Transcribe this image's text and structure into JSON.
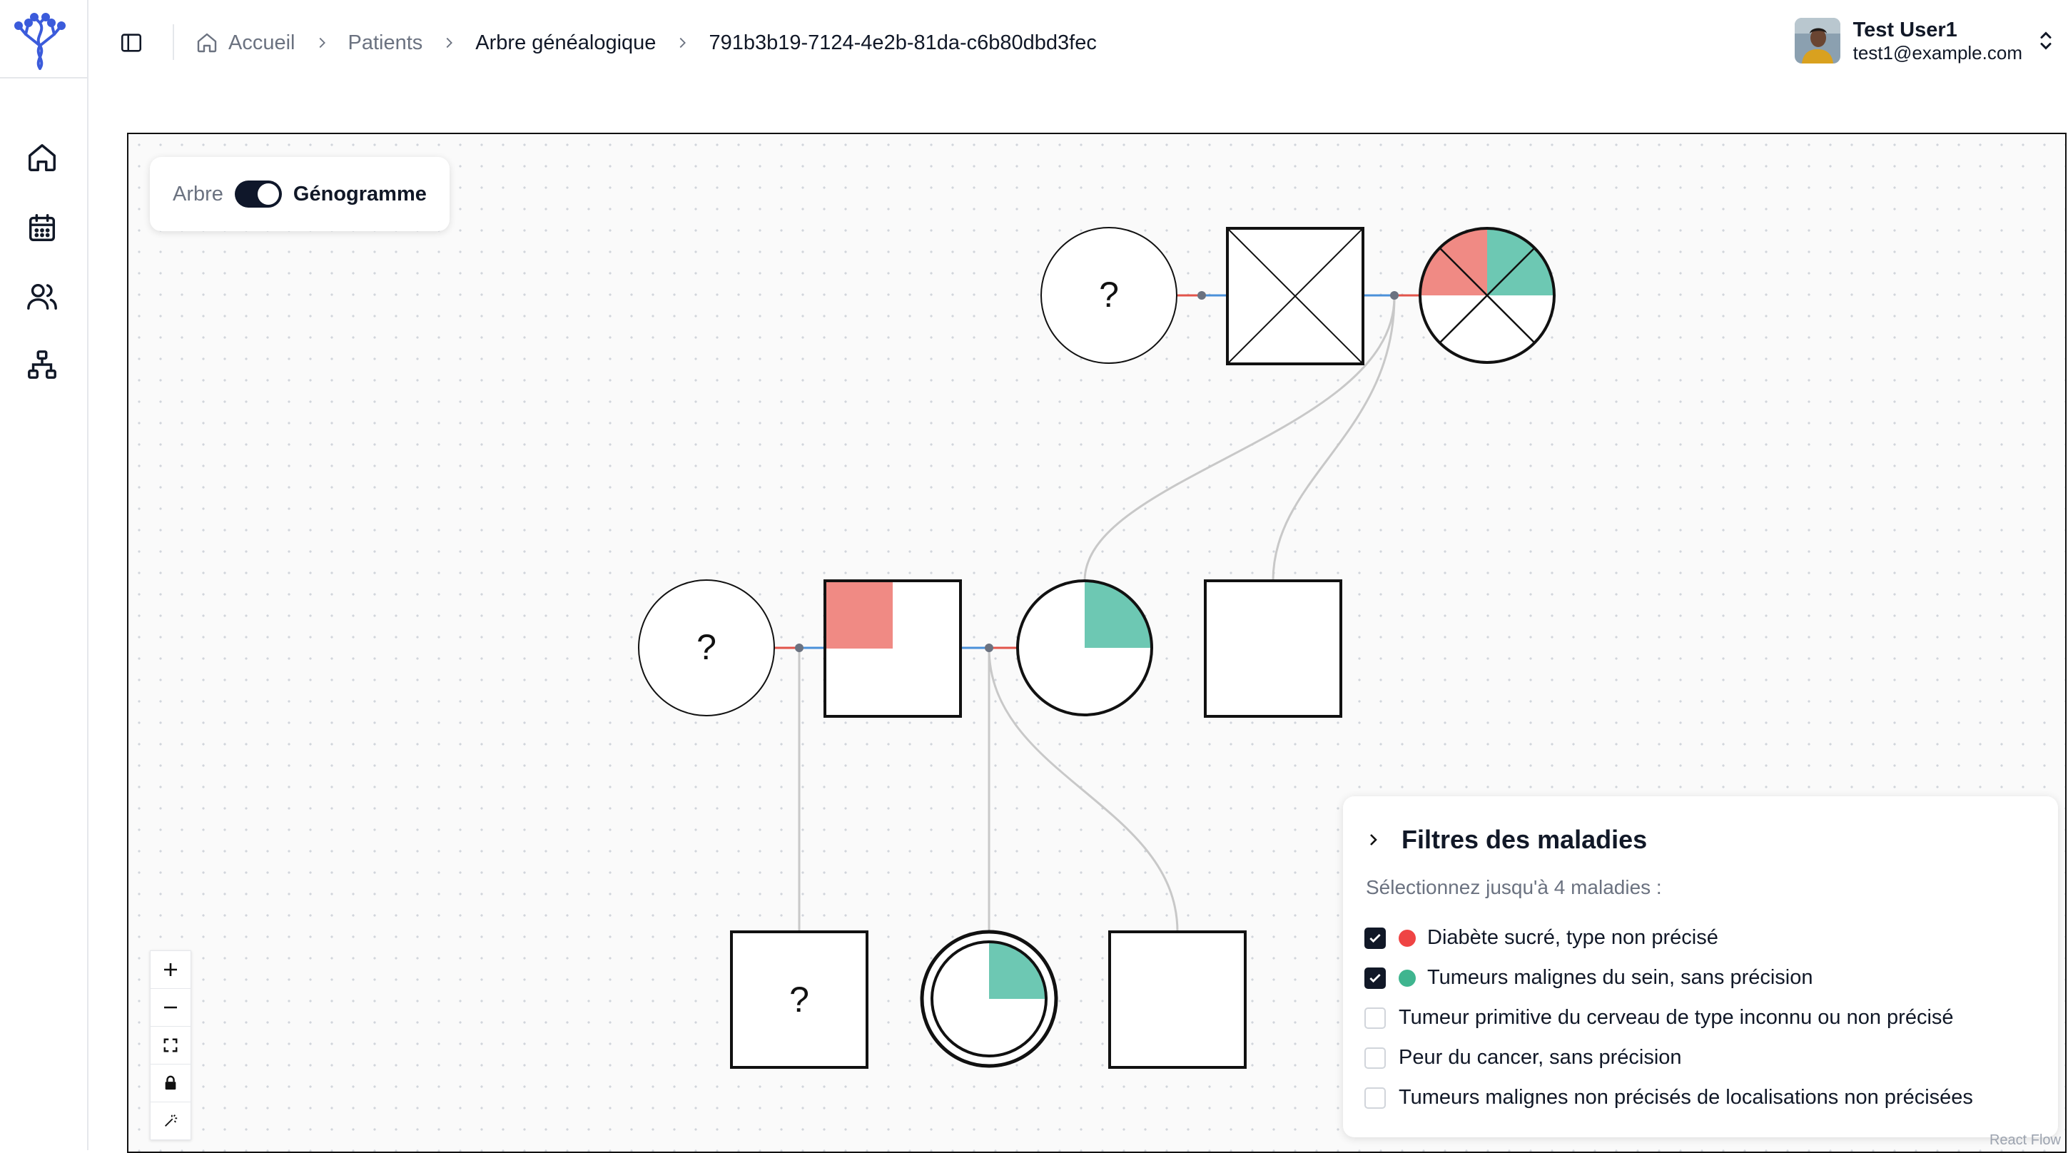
{
  "breadcrumb": {
    "home": "Accueil",
    "patients": "Patients",
    "tree": "Arbre généalogique",
    "id": "791b3b19-7124-4e2b-81da-c6b80dbd3fec"
  },
  "user": {
    "name": "Test User1",
    "email": "test1@example.com"
  },
  "mode_toggle": {
    "left": "Arbre",
    "right": "Génogramme",
    "active": "Génogramme"
  },
  "pedigree": {
    "unknown_marker": "?"
  },
  "filters": {
    "title": "Filtres des maladies",
    "subtitle": "Sélectionnez jusqu'à 4 maladies :",
    "items": [
      {
        "label": "Diabète sucré, type non précisé",
        "checked": true,
        "color": "#ef4444"
      },
      {
        "label": "Tumeurs malignes du sein, sans précision",
        "checked": true,
        "color": "#3fb58f"
      },
      {
        "label": "Tumeur primitive du cerveau de type inconnu ou non précisé",
        "checked": false
      },
      {
        "label": "Peur du cancer, sans précision",
        "checked": false
      },
      {
        "label": "Tumeurs malignes non précisés de localisations non précisées",
        "checked": false
      }
    ]
  },
  "colors": {
    "disease_1": "#f08a84",
    "disease_2": "#6dc8b3",
    "partner_line_red": "#e2544a",
    "partner_line_blue": "#4a90d9"
  },
  "attribution": "React Flow"
}
